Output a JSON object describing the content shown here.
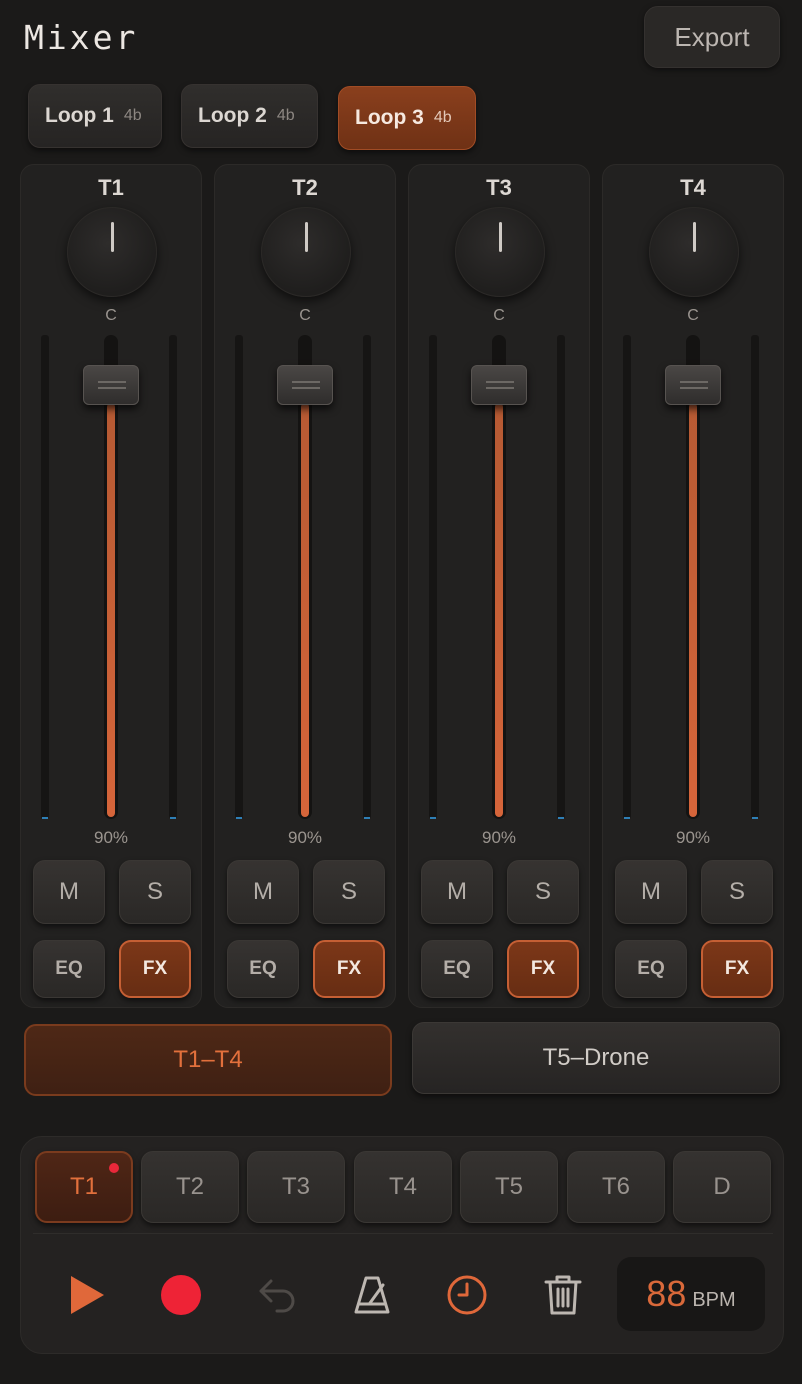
{
  "header": {
    "title": "Mixer",
    "export_label": "Export"
  },
  "loops": [
    {
      "label": "Loop 1",
      "beats": "4b",
      "active": false
    },
    {
      "label": "Loop 2",
      "beats": "4b",
      "active": false
    },
    {
      "label": "Loop 3",
      "beats": "4b",
      "active": true
    }
  ],
  "channels": [
    {
      "name": "T1",
      "pan": "C",
      "volume": "90%",
      "volume_level": 0.9,
      "mute_label": "M",
      "solo_label": "S",
      "eq_label": "EQ",
      "fx_label": "FX",
      "fx_on": true
    },
    {
      "name": "T2",
      "pan": "C",
      "volume": "90%",
      "volume_level": 0.9,
      "mute_label": "M",
      "solo_label": "S",
      "eq_label": "EQ",
      "fx_label": "FX",
      "fx_on": true
    },
    {
      "name": "T3",
      "pan": "C",
      "volume": "90%",
      "volume_level": 0.9,
      "mute_label": "M",
      "solo_label": "S",
      "eq_label": "EQ",
      "fx_label": "FX",
      "fx_on": true
    },
    {
      "name": "T4",
      "pan": "C",
      "volume": "90%",
      "volume_level": 0.9,
      "mute_label": "M",
      "solo_label": "S",
      "eq_label": "EQ",
      "fx_label": "FX",
      "fx_on": true
    }
  ],
  "group_tabs": [
    {
      "label": "T1–T4",
      "active": true
    },
    {
      "label": "T5–Drone",
      "active": false
    }
  ],
  "track_tabs": [
    {
      "label": "T1",
      "active": true,
      "recording": true
    },
    {
      "label": "T2",
      "active": false
    },
    {
      "label": "T3",
      "active": false
    },
    {
      "label": "T4",
      "active": false
    },
    {
      "label": "T5",
      "active": false
    },
    {
      "label": "T6",
      "active": false
    },
    {
      "label": "D",
      "active": false
    }
  ],
  "transport": {
    "icons": [
      "play-icon",
      "record-icon",
      "undo-icon",
      "metronome-icon",
      "clock-icon",
      "trash-icon"
    ],
    "bpm_value": "88",
    "bpm_unit": "BPM"
  },
  "colors": {
    "accent": "#d6653a",
    "record": "#e8283a",
    "background": "#1b1a19"
  }
}
